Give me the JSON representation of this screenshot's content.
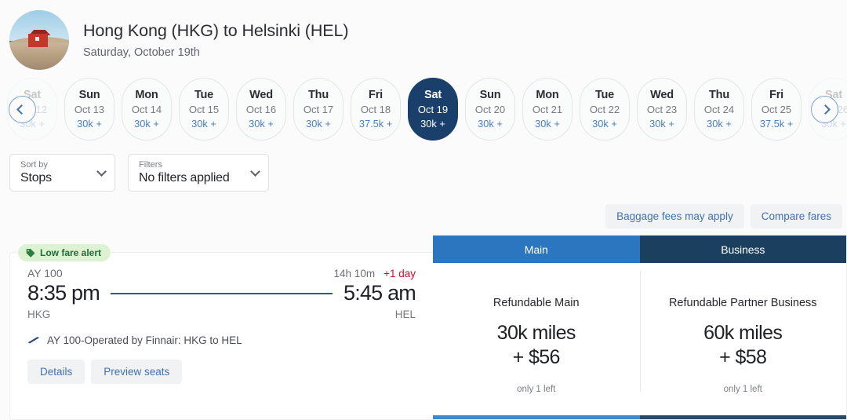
{
  "header": {
    "avatar_name": "destination-photo",
    "title": "Hong Kong (HKG) to Helsinki (HEL)",
    "subtitle": "Saturday, October 19th"
  },
  "carousel": {
    "prev_label": "chevron-left",
    "next_label": "chevron-right",
    "dates": [
      {
        "dow": "Sat",
        "date": "Oct 12",
        "price": "30k +",
        "selected": false,
        "faded": true
      },
      {
        "dow": "Sun",
        "date": "Oct 13",
        "price": "30k +",
        "selected": false,
        "faded": false
      },
      {
        "dow": "Mon",
        "date": "Oct 14",
        "price": "30k +",
        "selected": false,
        "faded": false
      },
      {
        "dow": "Tue",
        "date": "Oct 15",
        "price": "30k +",
        "selected": false,
        "faded": false
      },
      {
        "dow": "Wed",
        "date": "Oct 16",
        "price": "30k +",
        "selected": false,
        "faded": false
      },
      {
        "dow": "Thu",
        "date": "Oct 17",
        "price": "30k +",
        "selected": false,
        "faded": false
      },
      {
        "dow": "Fri",
        "date": "Oct 18",
        "price": "37.5k +",
        "selected": false,
        "faded": false
      },
      {
        "dow": "Sat",
        "date": "Oct 19",
        "price": "30k +",
        "selected": true,
        "faded": false
      },
      {
        "dow": "Sun",
        "date": "Oct 20",
        "price": "30k +",
        "selected": false,
        "faded": false
      },
      {
        "dow": "Mon",
        "date": "Oct 21",
        "price": "30k +",
        "selected": false,
        "faded": false
      },
      {
        "dow": "Tue",
        "date": "Oct 22",
        "price": "30k +",
        "selected": false,
        "faded": false
      },
      {
        "dow": "Wed",
        "date": "Oct 23",
        "price": "30k +",
        "selected": false,
        "faded": false
      },
      {
        "dow": "Thu",
        "date": "Oct 24",
        "price": "30k +",
        "selected": false,
        "faded": false
      },
      {
        "dow": "Fri",
        "date": "Oct 25",
        "price": "37.5k +",
        "selected": false,
        "faded": false
      },
      {
        "dow": "Sat",
        "date": "Oct 26",
        "price": "30k +",
        "selected": false,
        "faded": true
      }
    ]
  },
  "controls": {
    "sort_by": {
      "label": "Sort by",
      "value": "Stops"
    },
    "filters": {
      "label": "Filters",
      "value": "No filters applied"
    }
  },
  "fare_links": [
    {
      "label": "Baggage fees may apply"
    },
    {
      "label": "Compare fares"
    }
  ],
  "flight": {
    "badge": "Low fare alert",
    "flight_code": "AY 100",
    "duration": "14h 10m",
    "day_offset": "+1 day",
    "depart_time": "8:35 pm",
    "arrive_time": "5:45 am",
    "depart_airport": "HKG",
    "arrive_airport": "HEL",
    "operated_by": "AY 100-Operated by Finnair: HKG to HEL",
    "buttons": [
      {
        "label": "Details"
      },
      {
        "label": "Preview seats"
      }
    ]
  },
  "fares": {
    "tabs": [
      {
        "label": "Main",
        "color": "#2c76bf"
      },
      {
        "label": "Business",
        "color": "#1b3f5e"
      }
    ],
    "options": [
      {
        "cabin": "Main",
        "name": "Refundable Main",
        "miles": "30k miles",
        "cash": "+ $56",
        "availability": "only 1 left"
      },
      {
        "cabin": "Business",
        "name": "Refundable Partner Business",
        "miles": "60k miles",
        "cash": "+ $58",
        "availability": "only 1 left"
      }
    ]
  },
  "colors": {
    "selected_date": "#1b3f6b",
    "main_accent": "#2c76bf",
    "business_accent": "#1b3f5e",
    "link_blue": "#3f72ad",
    "alert_red": "#c8102e",
    "badge_green_bg": "#dcf3d2",
    "badge_green_text": "#1f6b3b"
  }
}
